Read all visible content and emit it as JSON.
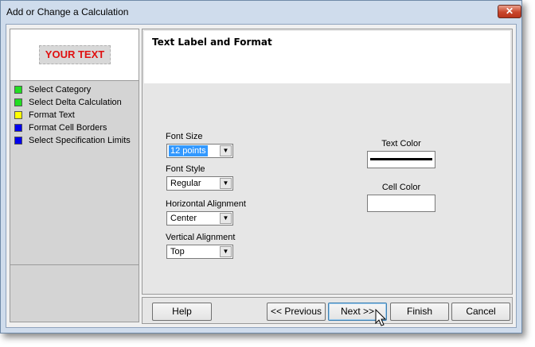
{
  "window": {
    "title": "Add or Change a Calculation",
    "close_label": "✕"
  },
  "preview": {
    "text": "YOUR TEXT"
  },
  "steps": [
    {
      "label": "Select Category",
      "color": "#22dd22"
    },
    {
      "label": "Select Delta Calculation",
      "color": "#22dd22"
    },
    {
      "label": "Format Text",
      "color": "#ffff00"
    },
    {
      "label": "Format Cell Borders",
      "color": "#0000ee"
    },
    {
      "label": "Select Specification Limits",
      "color": "#0000ee"
    }
  ],
  "panel": {
    "title": "Text Label and Format"
  },
  "form": {
    "font_size": {
      "label": "Font Size",
      "value": "12 points"
    },
    "font_style": {
      "label": "Font Style",
      "value": "Regular"
    },
    "horizontal_alignment": {
      "label": "Horizontal Alignment",
      "value": "Center"
    },
    "vertical_alignment": {
      "label": "Vertical Alignment",
      "value": "Top"
    },
    "text_color": {
      "label": "Text Color",
      "color": "#000000"
    },
    "cell_color": {
      "label": "Cell Color",
      "color": "#ffffff"
    }
  },
  "buttons": {
    "help": "Help",
    "previous": "<< Previous",
    "next": "Next >>",
    "finish": "Finish",
    "cancel": "Cancel"
  },
  "icons": {
    "dropdown": "▼",
    "cursor": "mouse-pointer-icon"
  }
}
